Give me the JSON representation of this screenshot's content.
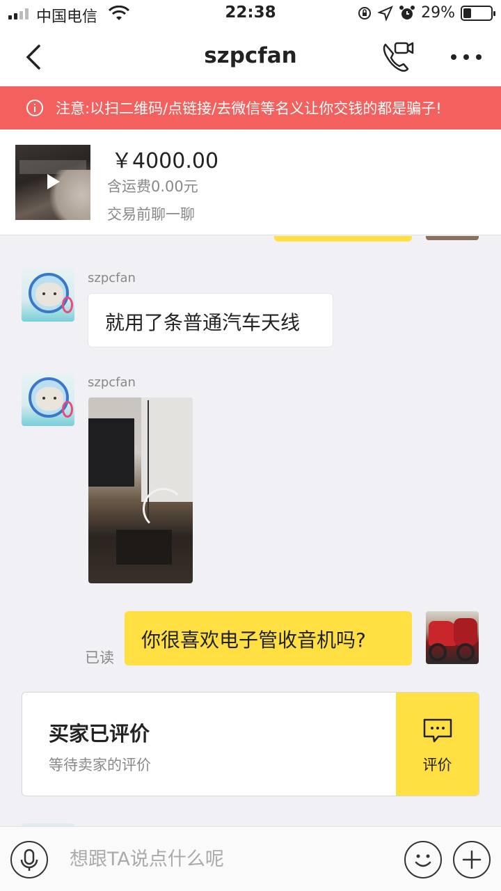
{
  "status_bar": {
    "carrier": "中国电信",
    "time": "22:38",
    "battery_percent": "29%",
    "battery_level": 0.29,
    "icons": [
      "signal-icon",
      "wifi-icon",
      "rotation-lock-icon",
      "location-icon",
      "alarm-icon",
      "battery-icon"
    ]
  },
  "nav": {
    "title": "szpcfan",
    "icons": [
      "back-chevron-icon",
      "video-call-icon",
      "more-icon"
    ]
  },
  "warning": {
    "text": "注意:以扫二维码/点链接/去微信等名义让你交钱的都是骗子!",
    "icon": "info-icon",
    "color": "#f3605d"
  },
  "product": {
    "price": "￥4000.00",
    "shipping": "含运费0.00元",
    "pre_chat": "交易前聊一聊"
  },
  "messages": [
    {
      "type": "text",
      "direction": "incoming",
      "sender": "szpcfan",
      "text": "就用了条普通汽车天线"
    },
    {
      "type": "image",
      "direction": "incoming",
      "sender": "szpcfan"
    },
    {
      "type": "text",
      "direction": "outgoing",
      "status": "已读",
      "text": "你很喜欢电子管收音机吗?"
    }
  ],
  "review_card": {
    "title": "买家已评价",
    "subtitle": "等待卖家的评价",
    "button_label": "评价"
  },
  "input_bar": {
    "placeholder": "想跟TA说点什么呢"
  },
  "colors": {
    "accent_yellow": "#ffdf41",
    "warning_red": "#f3605d",
    "chat_background": "#f0f0f5"
  }
}
